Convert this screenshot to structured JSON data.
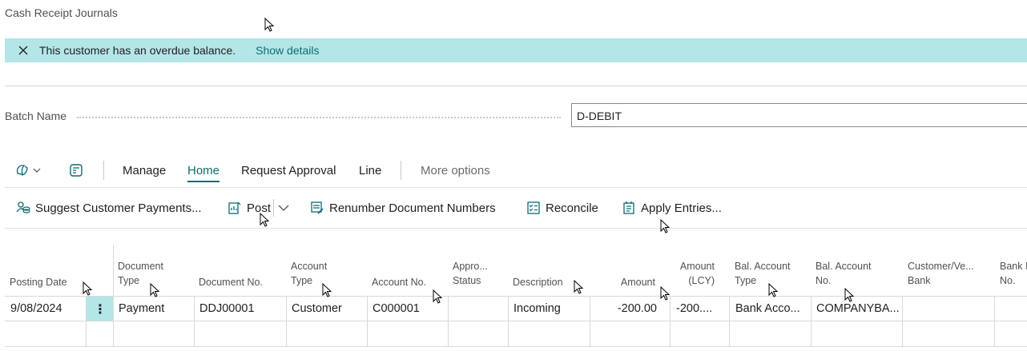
{
  "page": {
    "title": "Cash Receipt Journals"
  },
  "notification": {
    "message": "This customer has an overdue balance.",
    "link": "Show details"
  },
  "batch": {
    "label": "Batch Name",
    "value": "D-DEBIT"
  },
  "menu": {
    "items": [
      "Manage",
      "Home",
      "Request Approval",
      "Line"
    ],
    "active": "Home",
    "more": "More options"
  },
  "actions": {
    "suggest": "Suggest Customer Payments...",
    "post": "Post",
    "renumber": "Renumber Document Numbers",
    "reconcile": "Reconcile",
    "apply": "Apply Entries..."
  },
  "grid": {
    "headers": {
      "posting_date": "Posting Date",
      "document_type_1": "Document",
      "document_type_2": "Type",
      "document_no": "Document No.",
      "account_type_1": "Account",
      "account_type_2": "Type",
      "account_no": "Account No.",
      "approval_1": "Appro...",
      "approval_2": "Status",
      "description": "Description",
      "amount": "Amount",
      "amount_lcy_1": "Amount",
      "amount_lcy_2": "(LCY)",
      "bal_account_type_1": "Bal. Account",
      "bal_account_type_2": "Type",
      "bal_account_no_1": "Bal. Account",
      "bal_account_no_2": "No.",
      "customer_bank_1": "Customer/Ve...",
      "customer_bank_2": "Bank",
      "bank_no_1": "Bank I",
      "bank_no_2": "No."
    },
    "rows": [
      {
        "posting_date": "9/08/2024",
        "row_menu": "⋮",
        "document_type": "Payment",
        "document_no": "DDJ00001",
        "account_type": "Customer",
        "account_no": "C000001",
        "approval_status": "",
        "description": "Incoming",
        "amount": "-200.00",
        "amount_lcy": "-200....",
        "bal_account_type": "Bank Acco...",
        "bal_account_no": "COMPANYBA...",
        "customer_bank": ""
      }
    ]
  },
  "colors": {
    "accent": "#0d6b73",
    "notification_bg": "#b4e6e8"
  }
}
